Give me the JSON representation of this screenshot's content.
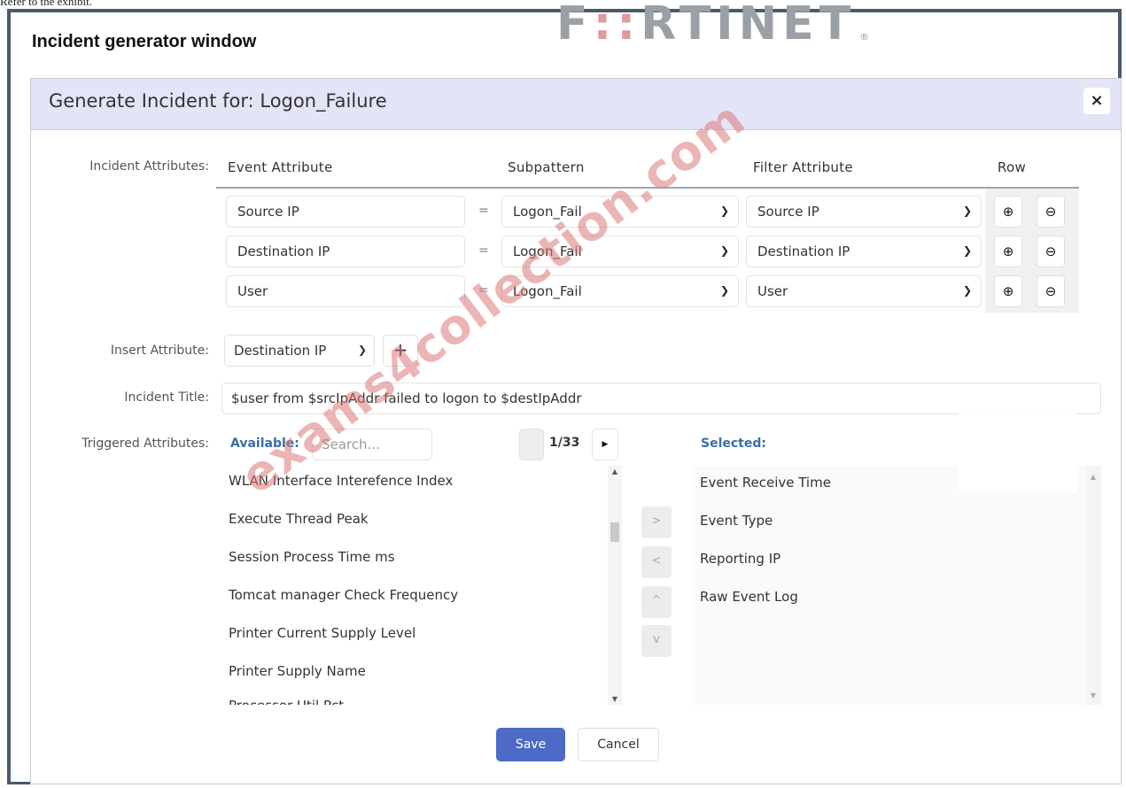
{
  "caption": "Refer to the exhibit.",
  "outer_title": "Incident generator window",
  "brand": {
    "prefix": "F",
    "accent": "::",
    "suffix": "RTINET",
    "reg": "®"
  },
  "modal": {
    "title": "Generate Incident for: Logon_Failure",
    "close_label": "×"
  },
  "attributes": {
    "label": "Incident Attributes:",
    "headers": {
      "event": "Event Attribute",
      "subpattern": "Subpattern",
      "filter": "Filter Attribute",
      "row": "Row"
    },
    "rows": [
      {
        "event": "Source IP",
        "op": "=",
        "subpattern": "Logon_Fail",
        "filter": "Source IP"
      },
      {
        "event": "Destination IP",
        "op": "=",
        "subpattern": "Logon_Fail",
        "filter": "Destination IP"
      },
      {
        "event": "User",
        "op": "=",
        "subpattern": "Logon_Fail",
        "filter": "User"
      }
    ],
    "add_icon": "plus-circle-icon",
    "remove_icon": "minus-circle-icon"
  },
  "insert": {
    "label": "Insert Attribute:",
    "value": "Destination IP",
    "add_icon": "plus-icon"
  },
  "incident_title": {
    "label": "Incident Title:",
    "value": "$user from $srcIpAddr failed to logon to $destIpAddr"
  },
  "triggered": {
    "label": "Triggered Attributes:",
    "available_label": "Available:",
    "search_placeholder": "Search...",
    "pager": "1/33",
    "selected_label": "Selected:",
    "available": [
      "WLAN Interface Interefence Index",
      "Execute Thread Peak",
      "Session Process Time ms",
      "Tomcat manager Check Frequency",
      "Printer Current Supply Level",
      "Printer Supply Name",
      "Processor Util Pct"
    ],
    "selected": [
      "Event Receive Time",
      "Event Type",
      "Reporting IP",
      "Raw Event Log"
    ],
    "movers": [
      ">",
      "<",
      "^",
      "v"
    ]
  },
  "buttons": {
    "save": "Save",
    "cancel": "Cancel"
  },
  "watermark": "exams4collection.com",
  "colors": {
    "header_bg": "#e4e4f7",
    "save_bg": "#4c6ac6",
    "link_blue": "#3a6ea8",
    "watermark": "#dc7878"
  }
}
